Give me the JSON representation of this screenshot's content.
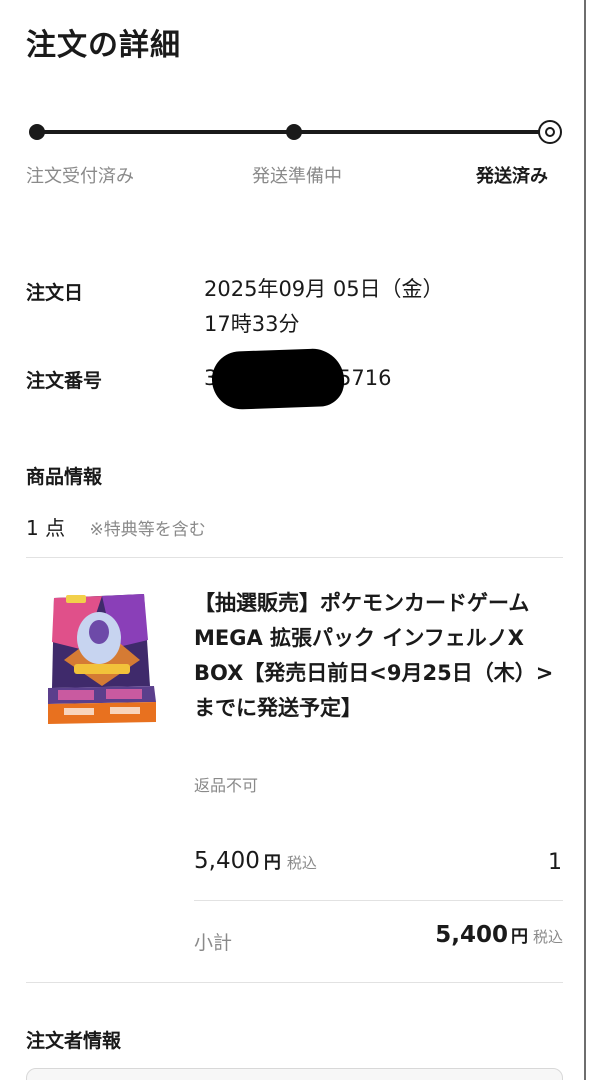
{
  "page": {
    "title": "注文の詳細"
  },
  "progress": {
    "steps": [
      {
        "label": "注文受付済み"
      },
      {
        "label": "発送準備中"
      },
      {
        "label": "発送済み"
      }
    ],
    "current_step": 3
  },
  "order": {
    "date_label": "注文日",
    "date_line1": "2025年09月 05日（金）",
    "date_line2": "17時33分",
    "number_label": "注文番号",
    "number_visible_start": "3",
    "number_visible_end": "5716"
  },
  "product_info": {
    "heading": "商品情報",
    "count": "1 点",
    "count_note": "※特典等を含む",
    "item": {
      "title": "【抽選販売】ポケモンカードゲーム MEGA 拡張パック インフェルノX BOX【発売日前日<9月25日（木）>までに発送予定】",
      "return_note": "返品不可",
      "price": "5,400",
      "currency": "円",
      "tax_label": "税込",
      "quantity": "1",
      "subtotal_label": "小計",
      "subtotal": "5,400",
      "image_icon": "pokemon-card-booster-box"
    }
  },
  "orderer": {
    "heading": "注文者情報"
  },
  "colors": {
    "text": "#1a1a1a",
    "muted": "#8a8a8a",
    "divider": "#e2e2e2"
  }
}
